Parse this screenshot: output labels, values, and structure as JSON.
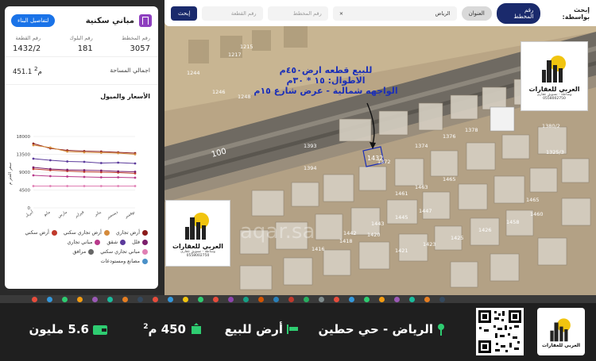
{
  "panel": {
    "title": "مباني سكنية",
    "view_button": "لتفاصيل البناء",
    "stats": [
      {
        "label": "رقم المخطط",
        "value": "3057"
      },
      {
        "label": "رقم البلوك",
        "value": "181"
      },
      {
        "label": "رقم القطعة",
        "value": "1432/2"
      }
    ],
    "area_label": "اجمالي المساحة",
    "area_value": "451.1 م",
    "area_unit_sup": "2",
    "chart_title": "الأسعار والميول"
  },
  "chart_data": {
    "type": "line",
    "categories": [
      "أبريل",
      "مايو",
      "مارس",
      "فبراير",
      "يناير",
      "ديسمبر",
      "نوفمبر"
    ],
    "ylim": [
      0,
      18000
    ],
    "yticks": [
      "0",
      "4500",
      "9000",
      "13500",
      "18000"
    ],
    "ylabel": "سعر المتر م",
    "series": [
      {
        "name": "أرض تجاري",
        "color": "#8b1a1a",
        "values": [
          13800,
          14000,
          14200,
          14300,
          14500,
          15000,
          16200
        ]
      },
      {
        "name": "أرض تجاري سكني",
        "color": "#d48a3b",
        "values": [
          13500,
          13800,
          13900,
          14000,
          14200,
          15200,
          15800
        ]
      },
      {
        "name": "أرض سكني",
        "color": "#c0392b",
        "values": [
          8700,
          8900,
          9000,
          9100,
          9300,
          9500,
          9800
        ]
      },
      {
        "name": "فلل",
        "color": "#7b1e6c",
        "values": [
          9100,
          9200,
          9400,
          9500,
          9600,
          9800,
          10200
        ]
      },
      {
        "name": "شقق",
        "color": "#5b3a9b",
        "values": [
          11200,
          11400,
          11300,
          11600,
          11700,
          12000,
          12400
        ]
      },
      {
        "name": "مباني تجاري",
        "color": "#b83a8b",
        "values": [
          7600,
          7700,
          7700,
          7800,
          7900,
          8000,
          8200
        ]
      },
      {
        "name": "مباني تجاري سكني",
        "color": "#e07fb4",
        "values": [
          5500,
          5500,
          5500,
          5500,
          5500,
          5500,
          5500
        ]
      },
      {
        "name": "مرافق",
        "color": "#666666",
        "values": [
          0,
          0,
          0,
          0,
          0,
          0,
          0
        ]
      },
      {
        "name": "مصانع ومستودعات",
        "color": "#4a90c8",
        "values": [
          0,
          0,
          0,
          0,
          0,
          0,
          0
        ]
      }
    ]
  },
  "search": {
    "label": "إبحث بواسطة:",
    "tab_active": "رقم المخطط",
    "tab_inactive": "العنوان",
    "city_value": "الرياض",
    "clear_icon": "×",
    "plan_placeholder": "رقم المخطط",
    "parcel_placeholder": "رقم القطعة",
    "search_button": "إبحث"
  },
  "map": {
    "annotation_line1": "للبيع قطعه ارض٤٥٠م",
    "annotation_line2": "الاطوال: ١٥ * ٣٠م",
    "annotation_line3": "الواجهه شمالية - عرض شارع ١٥م",
    "parcel_number": "1432",
    "road_number": "100",
    "plot_numbers": [
      "1215",
      "1217",
      "1244",
      "1246",
      "1248",
      "1393",
      "1374",
      "1376",
      "1378",
      "1380/2",
      "1325/3",
      "1372",
      "1394",
      "1442",
      "1443",
      "1445",
      "1447",
      "1461",
      "1463",
      "1465",
      "1465",
      "1416",
      "1418",
      "1420",
      "1421",
      "1423",
      "1425",
      "1426",
      "1458",
      "1460"
    ],
    "logo_name": "العربي للعقارات",
    "logo_sub": "وساطة - تسويق عقاري",
    "logo_phone": "0558002750",
    "watermark": "aqar.sa"
  },
  "footer": {
    "location": "الرياض - حي حطين",
    "type": "أرض للبيع",
    "area": "450 م",
    "area_sup": "2",
    "price": "5.6 مليون",
    "logo_name": "العربي للعقارات"
  },
  "colors": {
    "accent": "#1a2a6c",
    "brand_blue": "#1a73e8",
    "green": "#2ecc71",
    "annotation": "#1b2fb8"
  }
}
